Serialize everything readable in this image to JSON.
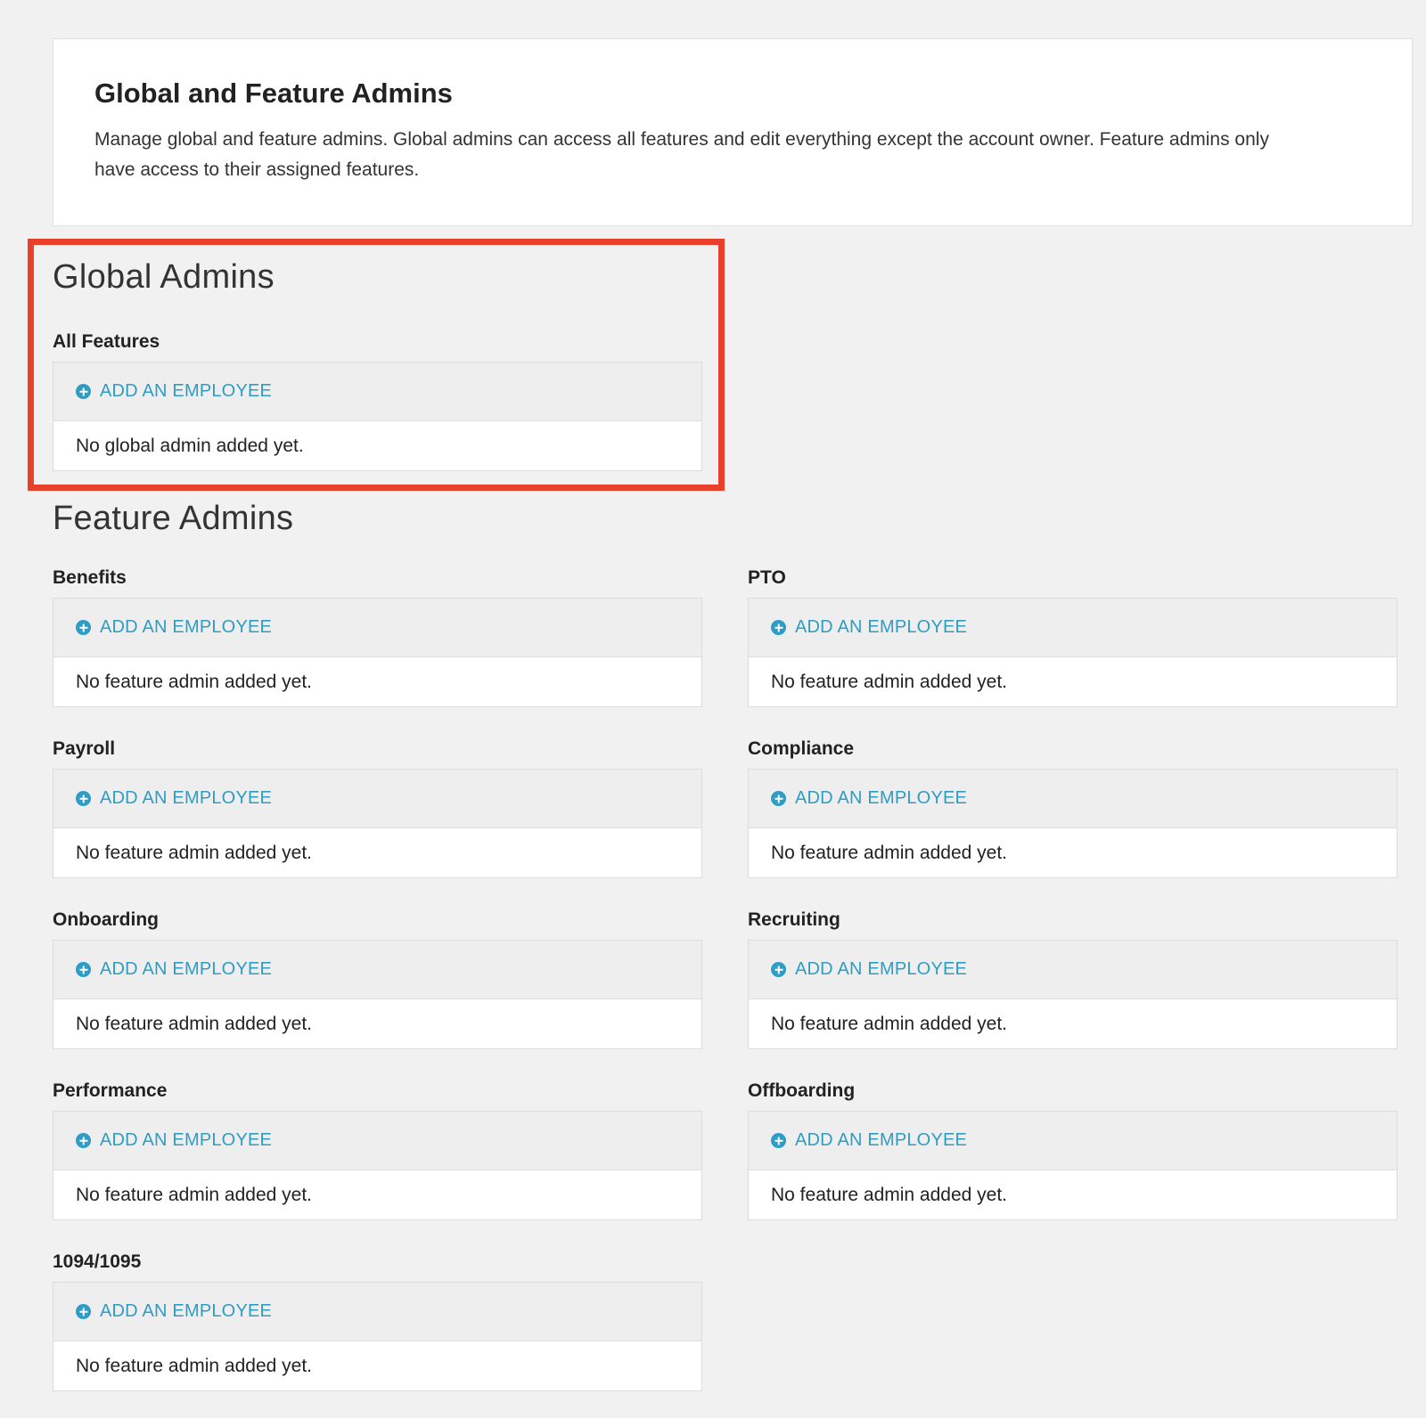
{
  "header": {
    "title": "Global and Feature Admins",
    "description": "Manage global and feature admins. Global admins can access all features and edit everything except the account owner. Feature admins only have access to their assigned features."
  },
  "global_admins": {
    "title": "Global Admins",
    "group": {
      "label": "All Features",
      "add_label": "ADD AN EMPLOYEE",
      "empty_text": "No global admin added yet."
    }
  },
  "feature_admins": {
    "title": "Feature Admins",
    "groups": [
      {
        "label": "Benefits",
        "add_label": "ADD AN EMPLOYEE",
        "empty_text": "No feature admin added yet."
      },
      {
        "label": "PTO",
        "add_label": "ADD AN EMPLOYEE",
        "empty_text": "No feature admin added yet."
      },
      {
        "label": "Payroll",
        "add_label": "ADD AN EMPLOYEE",
        "empty_text": "No feature admin added yet."
      },
      {
        "label": "Compliance",
        "add_label": "ADD AN EMPLOYEE",
        "empty_text": "No feature admin added yet."
      },
      {
        "label": "Onboarding",
        "add_label": "ADD AN EMPLOYEE",
        "empty_text": "No feature admin added yet."
      },
      {
        "label": "Recruiting",
        "add_label": "ADD AN EMPLOYEE",
        "empty_text": "No feature admin added yet."
      },
      {
        "label": "Performance",
        "add_label": "ADD AN EMPLOYEE",
        "empty_text": "No feature admin added yet."
      },
      {
        "label": "Offboarding",
        "add_label": "ADD AN EMPLOYEE",
        "empty_text": "No feature admin added yet."
      },
      {
        "label": "1094/1095",
        "add_label": "ADD AN EMPLOYEE",
        "empty_text": "No feature admin added yet."
      }
    ]
  },
  "colors": {
    "accent": "#2f9cc4",
    "highlight": "#e8402b",
    "background": "#f1f1f1"
  },
  "icons": {
    "add": "plus-circle-icon"
  }
}
